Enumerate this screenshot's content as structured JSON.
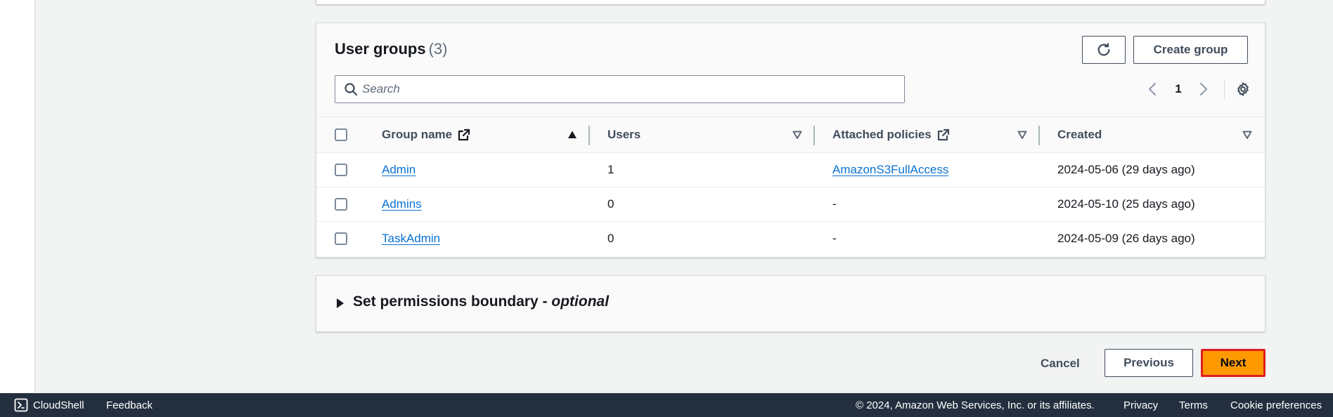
{
  "user_groups": {
    "title": "User groups",
    "count": "(3)",
    "create_button": "Create group",
    "search_placeholder": "Search",
    "pagination": {
      "current_page": "1"
    },
    "columns": [
      "Group name",
      "Users",
      "Attached policies",
      "Created"
    ],
    "rows": [
      {
        "group_name": "Admin",
        "users": "1",
        "policies": "AmazonS3FullAccess",
        "created": "2024-05-06 (29 days ago)"
      },
      {
        "group_name": "Admins",
        "users": "0",
        "policies": "-",
        "created": "2024-05-10 (25 days ago)"
      },
      {
        "group_name": "TaskAdmin",
        "users": "0",
        "policies": "-",
        "created": "2024-05-09 (26 days ago)"
      }
    ]
  },
  "permissions_boundary": {
    "title": "Set permissions boundary -",
    "optional": "optional"
  },
  "actions": {
    "cancel": "Cancel",
    "previous": "Previous",
    "next": "Next"
  },
  "footer": {
    "cloudshell": "CloudShell",
    "feedback": "Feedback",
    "copyright": "© 2024, Amazon Web Services, Inc. or its affiliates.",
    "privacy": "Privacy",
    "terms": "Terms",
    "cookie_preferences": "Cookie preferences"
  },
  "colors": {
    "link": "#0972d3",
    "primary_button": "#ff9900",
    "highlight_border": "#e01e1e",
    "footer_bg": "#232f3e"
  }
}
